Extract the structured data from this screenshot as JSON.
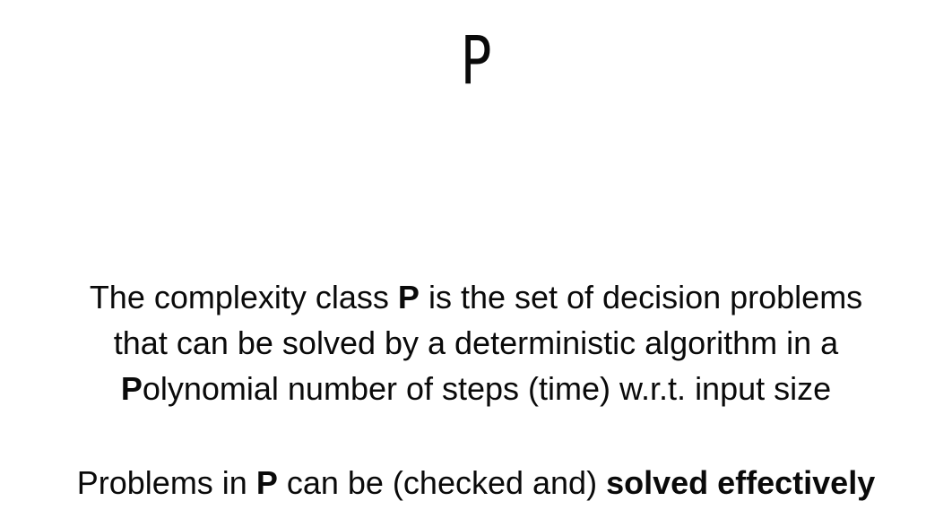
{
  "title": "P",
  "definition": {
    "line1": {
      "before": "The complexity class ",
      "bold": "P",
      "after": " is the set of decision problems"
    },
    "line2": {
      "text": "that can be solved by a deterministic algorithm in a"
    },
    "line3": {
      "bold": "P",
      "after": "olynomial number of steps (time) w.r.t. input size"
    }
  },
  "summary": {
    "before": "Problems in ",
    "bold_p": "P",
    "middle": " can be (checked and) ",
    "bold_end": "solved effectively"
  }
}
